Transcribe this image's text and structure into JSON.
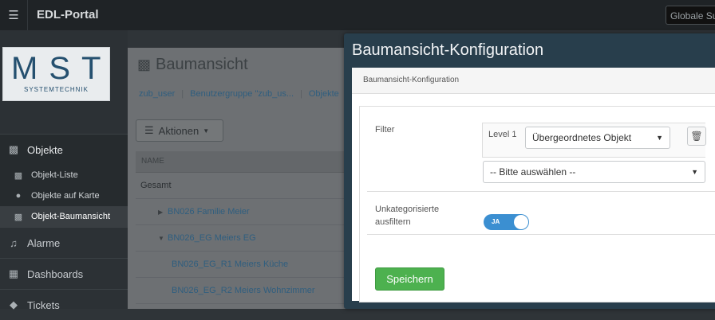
{
  "topbar": {
    "brand": "EDL-Portal",
    "menu_icon": "hamburger-icon",
    "search_placeholder": "Globale Suche"
  },
  "logo": {
    "main": "MST",
    "sub": "SYSTEMTECHNIK"
  },
  "sidebar": {
    "objekte": "Objekte",
    "sub_items": [
      "Objekt-Liste",
      "Objekte auf Karte",
      "Objekt-Baumansicht"
    ],
    "alarme": "Alarme",
    "dashboards": "Dashboards",
    "tickets": "Tickets"
  },
  "main": {
    "title": "Baumansicht",
    "breadcrumbs": [
      "zub_user",
      "Benutzergruppe \"zub_us...",
      "Objekte"
    ],
    "actions_label": "Aktionen",
    "table_header": "NAME",
    "rows": [
      "Gesamt",
      "BN026 Familie Meier",
      "BN026_EG Meiers EG",
      "BN026_EG_R1 Meiers Küche",
      "BN026_EG_R2 Meiers Wohnzimmer"
    ]
  },
  "modal": {
    "title": "Baumansicht-Konfiguration",
    "subheader": "Baumansicht-Konfiguration",
    "filter_label": "Filter",
    "level_label": "Level 1",
    "level_select_value": "Übergeordnetes Objekt",
    "second_select_value": "-- Bitte auswählen --",
    "uncategorized_label": "Unkategorisierte ausfiltern",
    "toggle_text": "JA",
    "toggle_on": true,
    "save_label": "Speichern"
  },
  "colors": {
    "accent": "#3b8fd1",
    "save": "#4db14f",
    "modal_header": "#283e4c"
  }
}
